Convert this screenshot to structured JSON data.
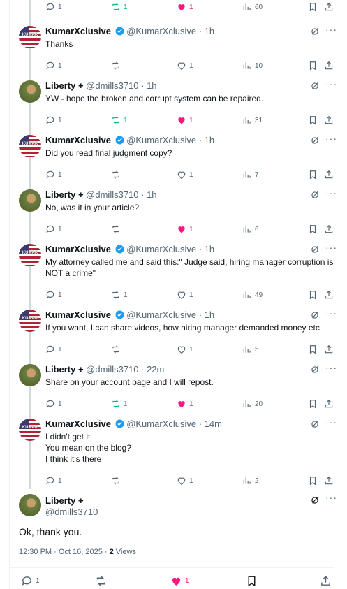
{
  "top_stats": {
    "reply": "1",
    "repost": "1",
    "like": "1",
    "views": "60"
  },
  "replies": [
    {
      "name": "KumarXclusive",
      "verified": true,
      "handle": "@KumarXclusive",
      "time": "· 1h",
      "text": "Thanks",
      "reply": "1",
      "repost": "",
      "like": "1",
      "views": "10",
      "liked": false,
      "reposted": false,
      "avatar": "flag"
    },
    {
      "name": "Liberty +",
      "verified": false,
      "handle": "@dmills3710",
      "time": "· 1h",
      "text": "YW - hope the broken and corrupt system can be repaired.",
      "reply": "1",
      "repost": "1",
      "like": "1",
      "views": "31",
      "liked": true,
      "reposted": true,
      "avatar": "photo"
    },
    {
      "name": "KumarXclusive",
      "verified": true,
      "handle": "@KumarXclusive",
      "time": "· 1h",
      "text": "Did you read final judgment copy?",
      "reply": "1",
      "repost": "",
      "like": "1",
      "views": "7",
      "liked": false,
      "reposted": false,
      "avatar": "flag"
    },
    {
      "name": "Liberty +",
      "verified": false,
      "handle": "@dmills3710",
      "time": "· 1h",
      "text": "No, was it in your article?",
      "reply": "1",
      "repost": "",
      "like": "1",
      "views": "6",
      "liked": true,
      "reposted": false,
      "avatar": "photo"
    },
    {
      "name": "KumarXclusive",
      "verified": true,
      "handle": "@KumarXclusive",
      "time": "· 1h",
      "text": "My attorney called me and said this:\" Judge said, hiring manager corruption is NOT a crime\"",
      "reply": "1",
      "repost": "1",
      "like": "1",
      "views": "49",
      "liked": false,
      "reposted": false,
      "avatar": "flag"
    },
    {
      "name": "KumarXclusive",
      "verified": true,
      "handle": "@KumarXclusive",
      "time": "· 1h",
      "text": "If you want, I can share videos, how hiring manager demanded money etc",
      "reply": "1",
      "repost": "",
      "like": "1",
      "views": "5",
      "liked": false,
      "reposted": false,
      "avatar": "flag"
    },
    {
      "name": "Liberty +",
      "verified": false,
      "handle": "@dmills3710",
      "time": "· 22m",
      "text": "Share on your account page and I will repost.",
      "reply": "1",
      "repost": "1",
      "like": "1",
      "views": "20",
      "liked": true,
      "reposted": true,
      "avatar": "photo"
    },
    {
      "name": "KumarXclusive",
      "verified": true,
      "handle": "@KumarXclusive",
      "time": "· 14m",
      "text_lines": [
        "I didn't get it",
        "You mean on the blog?",
        "I think it's there"
      ],
      "reply": "1",
      "repost": "",
      "like": "1",
      "views": "2",
      "liked": false,
      "reposted": false,
      "avatar": "flag"
    }
  ],
  "main_post": {
    "name": "Liberty +",
    "handle": "@dmills3710",
    "text": "Ok, thank you.",
    "timestamp": "12:30 PM · Oct 16, 2025 · ",
    "views_count": "2",
    "views_label": " Views",
    "reply": "1",
    "like": "1"
  },
  "avatar_text": "KUMAR",
  "colors": {
    "accent": "#1d9bf0",
    "like": "#f91880",
    "repost": "#00ba7c",
    "muted": "#536471"
  }
}
